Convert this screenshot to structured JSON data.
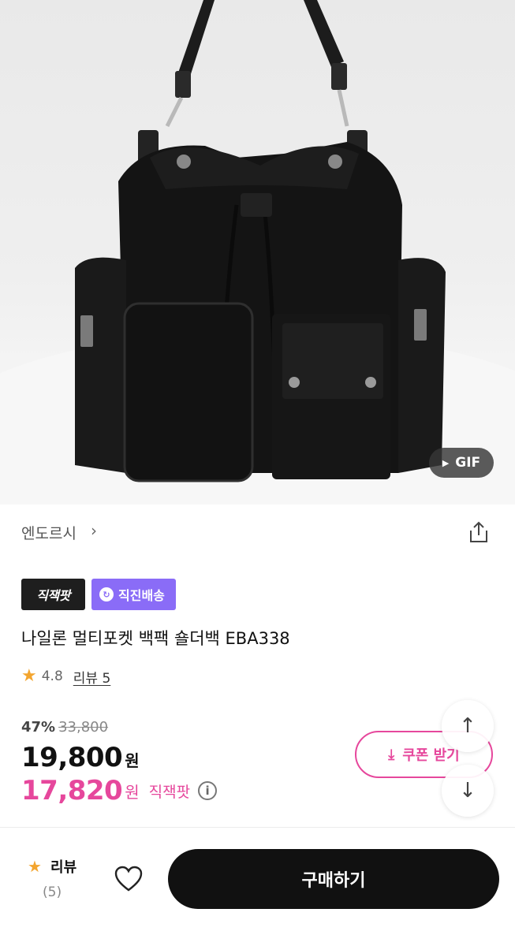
{
  "hero": {
    "gif_label": "GIF",
    "play_icon": "play-icon"
  },
  "brand": {
    "name": "엔도르시",
    "chevron": "chevron-right-icon",
    "share_icon": "share-icon"
  },
  "badges": {
    "zz_label": "직잭팟",
    "direct_label": "직진배송",
    "direct_icon": "direct-delivery-icon"
  },
  "product": {
    "title": "나일론 멀티포켓 백팩 숄더백 EBA338"
  },
  "rating": {
    "value": "4.8",
    "review_link": "리뷰 5"
  },
  "price": {
    "discount_rate": "47%",
    "original_price": "33,800",
    "sale_price": "19,800",
    "currency": "원",
    "zz_price": "17,820",
    "zz_currency": "원",
    "zz_label": "직잭팟"
  },
  "coupon": {
    "label": "쿠폰 받기",
    "icon": "download-icon"
  },
  "floating": {
    "up_icon": "arrow-up-icon",
    "down_icon": "arrow-down-icon"
  },
  "bottom_bar": {
    "review_label": "리뷰",
    "review_count": "(5)",
    "buy_label": "구매하기"
  },
  "colors": {
    "accent_pink": "#e6479c",
    "direct_purple": "#8a6cf7",
    "star": "#f3a52f",
    "buy_bg": "#111111"
  }
}
